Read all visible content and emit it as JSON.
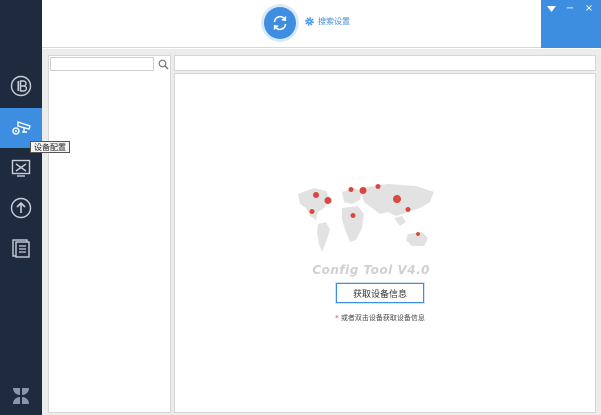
{
  "header": {
    "search_settings_label": "搜索设置"
  },
  "sidebar": {
    "items": [
      {
        "name": "ip-icon",
        "active": false
      },
      {
        "name": "device-config-icon",
        "active": true
      },
      {
        "name": "tools-icon",
        "active": false
      },
      {
        "name": "upgrade-icon",
        "active": false
      },
      {
        "name": "document-icon",
        "active": false
      },
      {
        "name": "apps-icon",
        "active": false
      }
    ],
    "tooltip": "设备配置"
  },
  "window_controls": {
    "menu": "▼",
    "minimize": "−",
    "close": "×"
  },
  "left_panel": {
    "search_value": "",
    "search_placeholder": ""
  },
  "main": {
    "brand_text": "Config Tool  V4.0",
    "get_info_label": "获取设备信息",
    "hint_star": "*",
    "hint_text": "或者双击设备获取设备信息"
  },
  "colors": {
    "accent": "#3d8de0",
    "sidebar": "#1e2a3d",
    "pin": "#d9473f"
  }
}
